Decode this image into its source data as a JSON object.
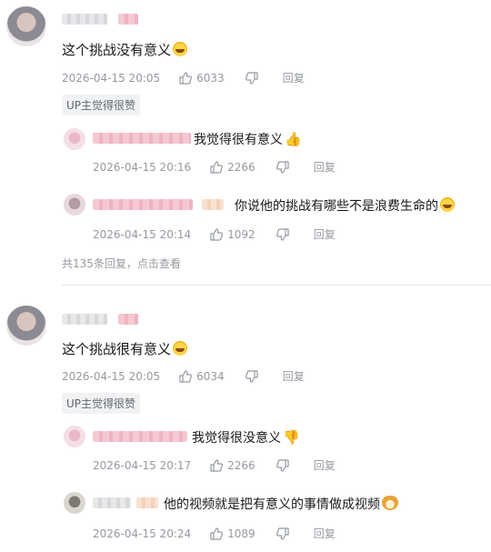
{
  "comments": [
    {
      "text": "这个挑战没有意义",
      "time": "2026-04-15 20:05",
      "likes": "6033",
      "reply_label": "回复",
      "tag": "UP主觉得很赞",
      "replies": [
        {
          "text": "我觉得很有意义",
          "time": "2026-04-15 20:16",
          "likes": "2266",
          "reply_label": "回复"
        },
        {
          "text": "你说他的挑战有哪些不是浪费生命的",
          "time": "2026-04-15 20:14",
          "likes": "1092",
          "reply_label": "回复"
        }
      ],
      "more_replies": "共135条回复，点击查看"
    },
    {
      "text": "这个挑战很有意义",
      "time": "2026-04-15 20:05",
      "likes": "6034",
      "reply_label": "回复",
      "tag": "UP主觉得很赞",
      "replies": [
        {
          "text": "我觉得很没意义",
          "time": "2026-04-15 20:17",
          "likes": "2266",
          "reply_label": "回复"
        },
        {
          "text": "他的视频就是把有意义的事情做成视频",
          "time": "2026-04-15 20:24",
          "likes": "1089",
          "reply_label": "回复"
        }
      ]
    }
  ],
  "icons": {
    "like": "thumbs-up-icon",
    "dislike": "thumbs-down-icon"
  },
  "colors": {
    "meta_text": "#9499a0",
    "tag_bg": "#f1f2f3",
    "divider": "#e3e5e7"
  }
}
